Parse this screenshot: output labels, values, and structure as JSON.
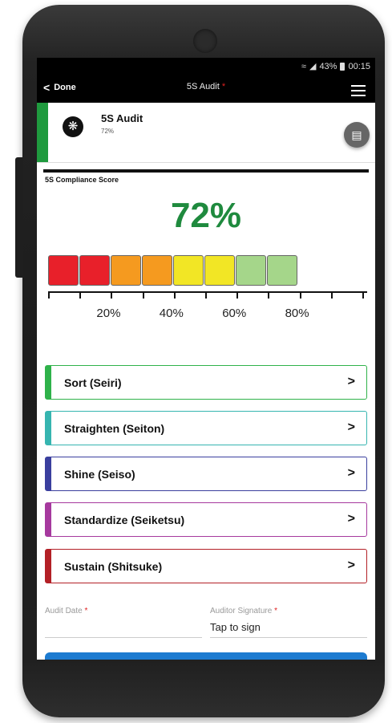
{
  "status_bar": {
    "battery": "43%",
    "time": "00:15"
  },
  "app_bar": {
    "back_label": "Done",
    "title": "5S Audit",
    "required_mark": "*"
  },
  "header": {
    "title": "5S Audit",
    "percent": "72%"
  },
  "score_section": {
    "label": "5S Compliance Score",
    "value": "72%",
    "level_percent": 72,
    "segment_colors": [
      "#e8202a",
      "#e8202a",
      "#f59a1f",
      "#f59a1f",
      "#f2e625",
      "#f2e625",
      "#a5d68a",
      "#a5d68a"
    ],
    "tick_labels": [
      "20%",
      "40%",
      "60%",
      "80%"
    ]
  },
  "categories": [
    {
      "label": "Sort (Seiri)",
      "color": "#2fb24a"
    },
    {
      "label": "Straighten (Seiton)",
      "color": "#36b5b0"
    },
    {
      "label": "Shine (Seiso)",
      "color": "#3a3f9e"
    },
    {
      "label": "Standardize (Seiketsu)",
      "color": "#a6399e"
    },
    {
      "label": "Sustain (Shitsuke)",
      "color": "#b32026"
    }
  ],
  "form": {
    "audit_date_label": "Audit Date",
    "auditor_signature_label": "Auditor Signature",
    "required_mark": "*",
    "signature_value": "Tap to sign"
  },
  "colors": {
    "accent_green": "#1f8a3e",
    "primary_blue": "#1d7bd0"
  }
}
